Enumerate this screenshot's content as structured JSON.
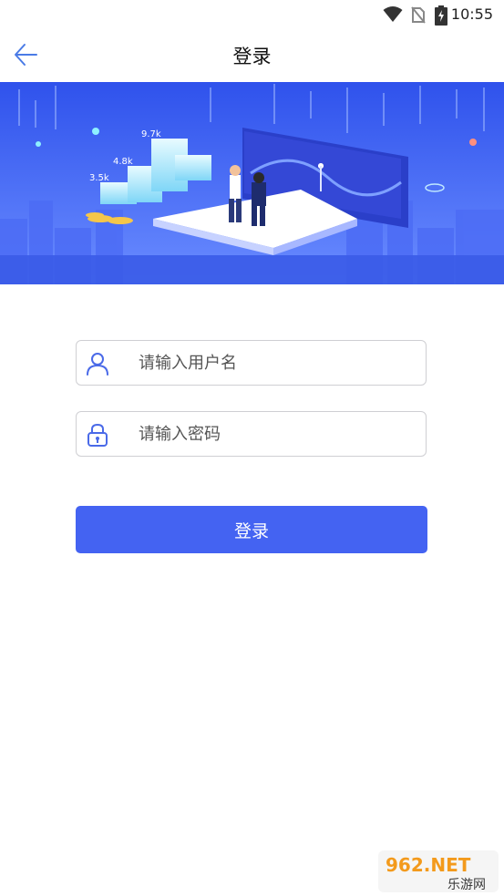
{
  "status_bar": {
    "time": "10:55",
    "icons": [
      "wifi-icon",
      "no-sim-icon",
      "battery-charging-icon"
    ]
  },
  "header": {
    "title": "登录",
    "back_icon": "arrow-left-icon"
  },
  "banner": {
    "labels": [
      "9.7k",
      "4.8k",
      "3.5k"
    ]
  },
  "form": {
    "username_placeholder": "请输入用户名",
    "password_placeholder": "请输入密码",
    "login_label": "登录"
  },
  "watermark": {
    "brand": "962.NET",
    "sub": "乐游网"
  },
  "colors": {
    "accent": "#4463f2",
    "banner_top": "#2f52ec",
    "banner_bottom": "#6a8cff"
  }
}
